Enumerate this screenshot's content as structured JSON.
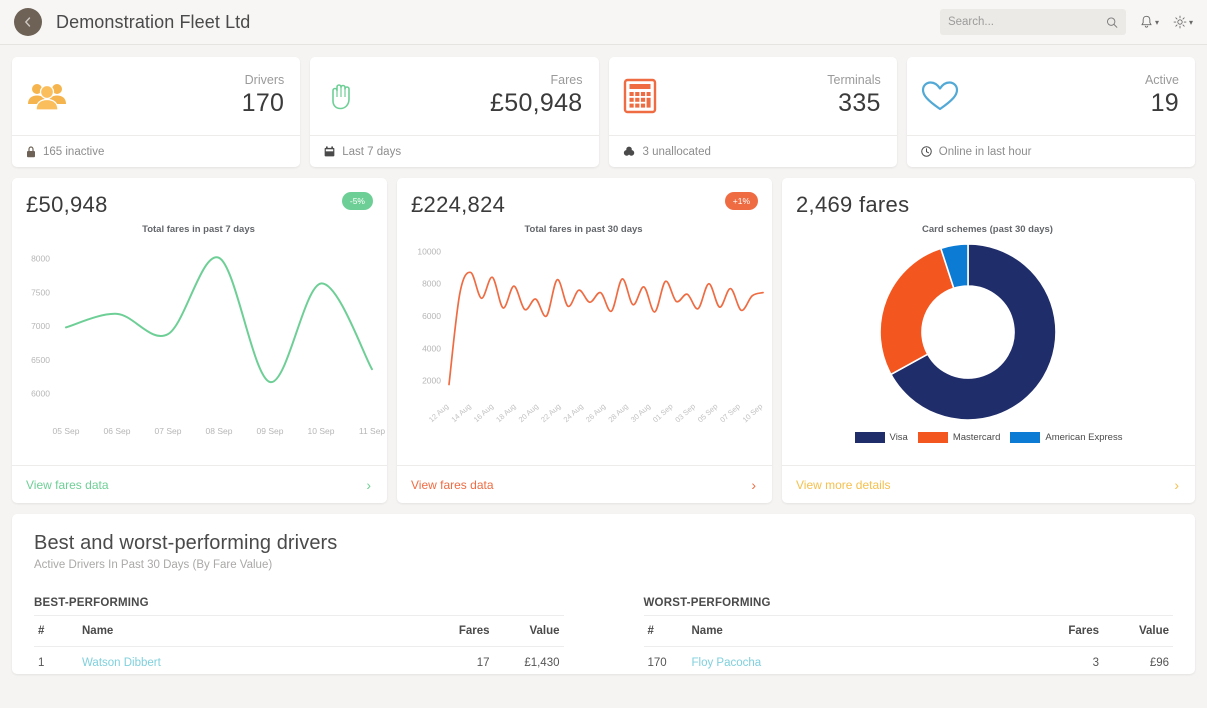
{
  "topbar": {
    "back_icon": "chevron-left-icon",
    "title": "Demonstration Fleet Ltd",
    "search_placeholder": "Search...",
    "search_value": "",
    "search_icon": "search-icon",
    "bell_icon": "bell-icon",
    "gear_icon": "gear-icon",
    "caret": "▾"
  },
  "stats": [
    {
      "icon": "users-group-icon",
      "icon_color": "#f5b44d",
      "label": "Drivers",
      "value": "170",
      "foot_icon": "lock-icon",
      "foot_text": "165 inactive"
    },
    {
      "icon": "hand-icon",
      "icon_color": "#6ecf96",
      "label": "Fares",
      "value": "£50,948",
      "foot_icon": "calendar-icon",
      "foot_text": "Last 7 days"
    },
    {
      "icon": "calculator-icon",
      "icon_color": "#ef6c43",
      "label": "Terminals",
      "value": "335",
      "foot_icon": "cubes-icon",
      "foot_text": "3 unallocated"
    },
    {
      "icon": "heart-icon",
      "icon_color": "#53a9d6",
      "label": "Active",
      "value": "19",
      "foot_icon": "clock-icon",
      "foot_text": "Online in last hour"
    }
  ],
  "cards": {
    "seven_day": {
      "amount": "£50,948",
      "badge": "-5%",
      "badge_color": "#6ecf96",
      "footer_label": "View fares data",
      "footer_chevron": "›"
    },
    "thirty_day": {
      "amount": "£224,824",
      "badge": "+1%",
      "badge_color": "#ef6c43",
      "footer_label": "View fares data",
      "footer_chevron": "›"
    },
    "schemes": {
      "amount": "2,469 fares",
      "footer_label": "View more details",
      "footer_chevron": "›"
    }
  },
  "chart_data": [
    {
      "type": "line",
      "title": "Total fares in past 7 days",
      "xlabel": "",
      "ylabel": "",
      "ylim": [
        5800,
        8200
      ],
      "yticks": [
        6000,
        6500,
        7000,
        7500,
        8000
      ],
      "grid": false,
      "line_color": "#6ecf96",
      "categories": [
        "05 Sep",
        "06 Sep",
        "07 Sep",
        "08 Sep",
        "09 Sep",
        "10 Sep",
        "11 Sep"
      ],
      "values": [
        6980,
        7180,
        6880,
        8010,
        6170,
        7630,
        6360
      ]
    },
    {
      "type": "line",
      "title": "Total fares in past 30 days",
      "xlabel": "",
      "ylabel": "",
      "ylim": [
        1600,
        10400
      ],
      "yticks": [
        2000,
        4000,
        6000,
        8000,
        10000
      ],
      "grid": false,
      "line_color": "#ef6c43",
      "categories": [
        "12 Aug",
        "14 Aug",
        "16 Aug",
        "18 Aug",
        "20 Aug",
        "22 Aug",
        "24 Aug",
        "26 Aug",
        "28 Aug",
        "30 Aug",
        "01 Sep",
        "03 Sep",
        "05 Sep",
        "07 Sep",
        "10 Sep"
      ],
      "values": [
        1750,
        7400,
        8700,
        7100,
        8400,
        6500,
        7850,
        6400,
        7050,
        6000,
        8250,
        6600,
        7600,
        6850,
        7450,
        6300,
        8300,
        6700,
        7800,
        6250,
        8150,
        6900,
        7350,
        6450,
        8000,
        6550,
        7700,
        6350,
        7250,
        7450
      ]
    },
    {
      "type": "pie",
      "title": "Card schemes (past 30 days)",
      "labels": [
        "Visa",
        "Mastercard",
        "American Express"
      ],
      "values": [
        67,
        28,
        5
      ],
      "colors": [
        "#1f2d6b",
        "#f4561f",
        "#0b7bd4"
      ],
      "legend_position": "bottom",
      "donut": true
    }
  ],
  "bottom": {
    "title": "Best and worst-performing drivers",
    "subtitle": "Active Drivers In Past 30 Days (By Fare Value)",
    "best": {
      "heading": "BEST-PERFORMING",
      "columns": [
        "#",
        "Name",
        "Fares",
        "Value"
      ],
      "rows": [
        {
          "rank": "1",
          "name": "Watson Dibbert",
          "fares": "17",
          "value": "£1,430"
        }
      ]
    },
    "worst": {
      "heading": "WORST-PERFORMING",
      "columns": [
        "#",
        "Name",
        "Fares",
        "Value"
      ],
      "rows": [
        {
          "rank": "170",
          "name": "Floy Pacocha",
          "fares": "3",
          "value": "£96"
        }
      ]
    }
  }
}
